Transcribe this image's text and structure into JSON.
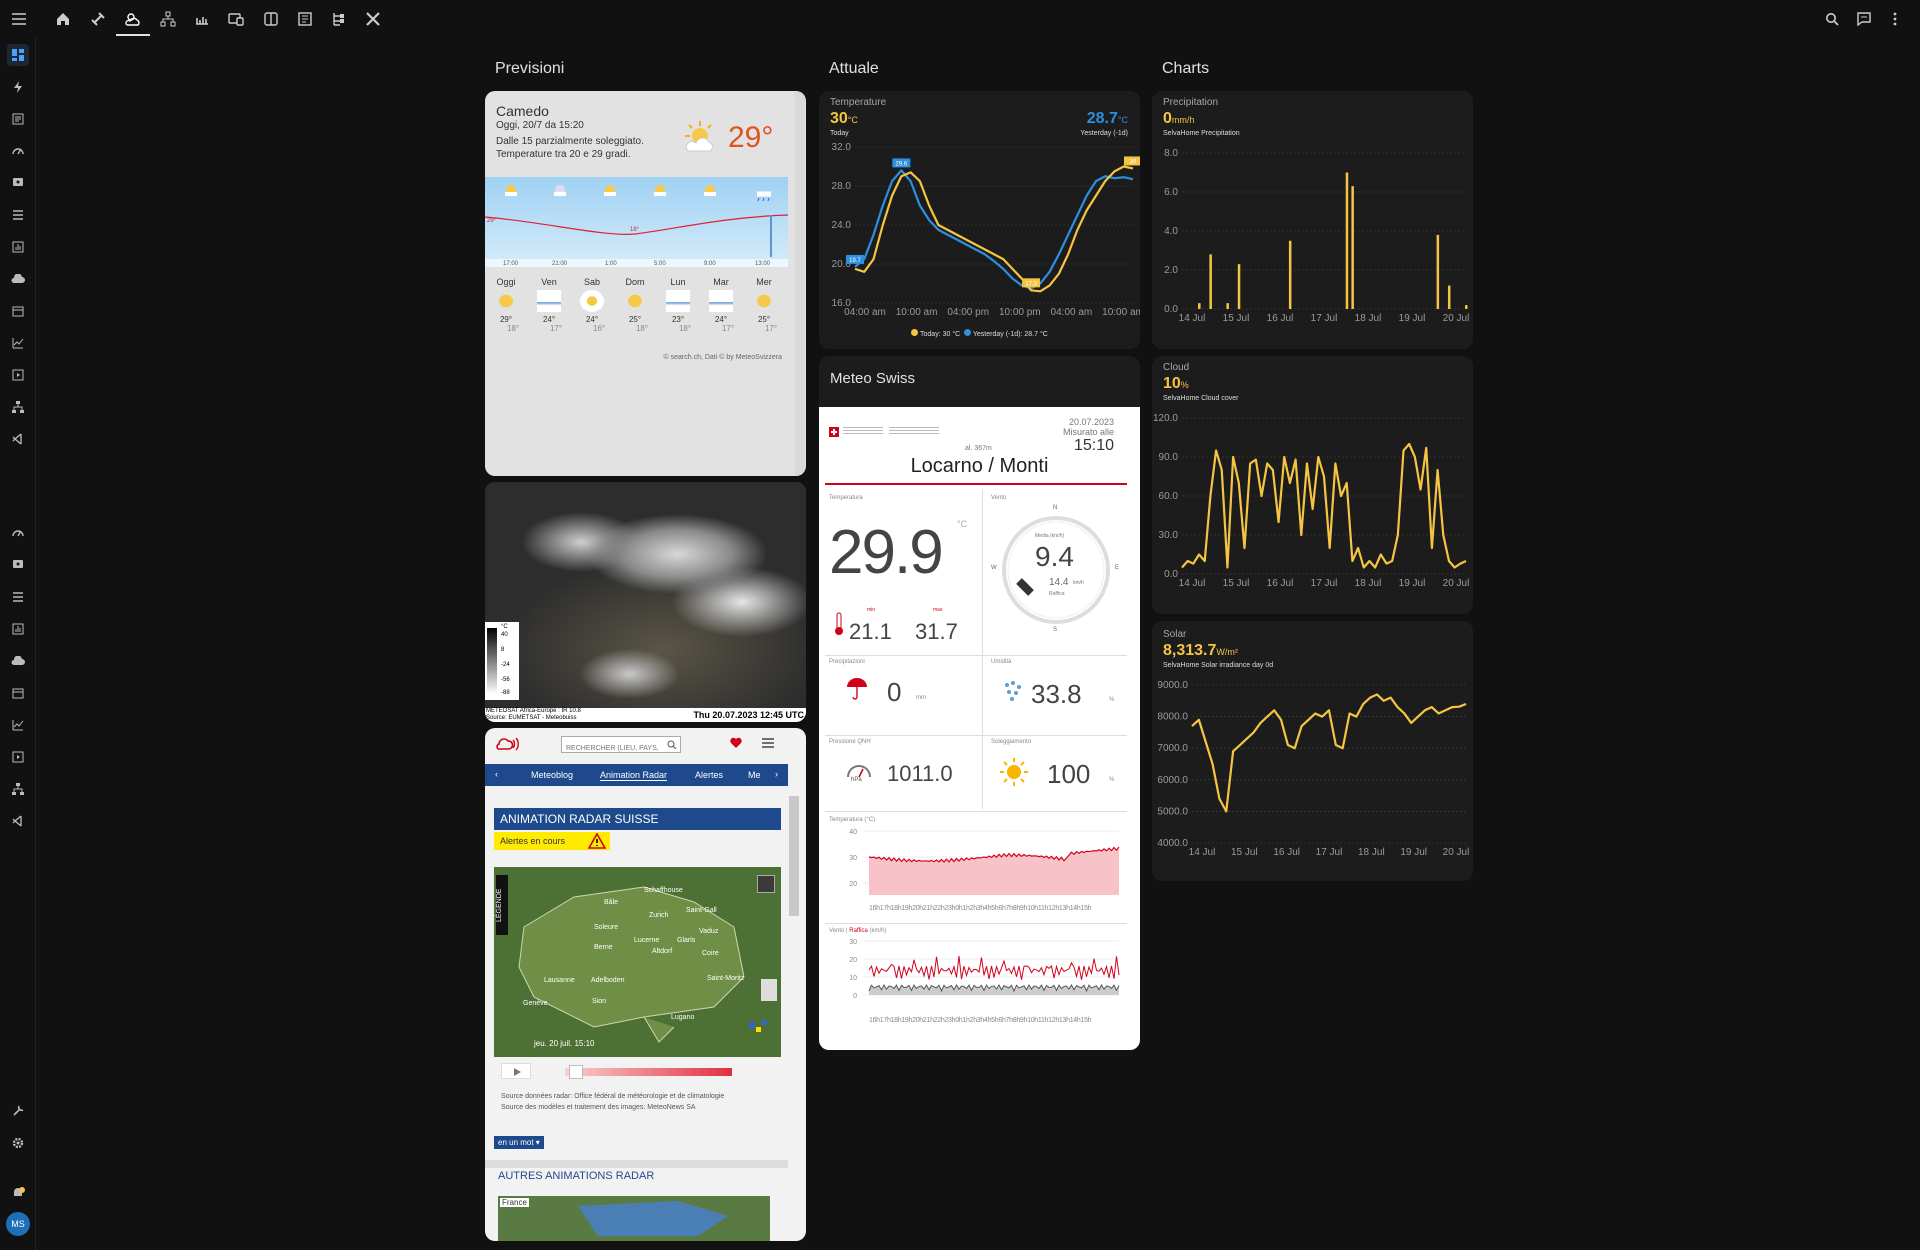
{
  "topbar": {
    "icons": [
      "menu-icon",
      "home-icon",
      "plug-icon",
      "weather-icon",
      "network-icon",
      "energy-icon",
      "media-icon",
      "tablet-icon",
      "panel-icon",
      "tree-icon",
      "tools-icon"
    ],
    "right_icons": [
      "search-icon",
      "chat-icon",
      "more-icon"
    ]
  },
  "columns": {
    "previsioni": "Previsioni",
    "attuale": "Attuale",
    "charts": "Charts"
  },
  "forecast": {
    "location": "Camedo",
    "date": "Oggi, 20/7 da 15:20",
    "desc1": "Dalle 15 parzialmente soleggiato.",
    "desc2": "Temperature tra 20 e 29 gradi.",
    "temp": "29°",
    "hours": [
      "17:00",
      "21:00",
      "1:00",
      "5:00",
      "9:00",
      "13:00"
    ],
    "hi_mark": "29°",
    "lo_mark": "18°",
    "days": [
      {
        "name": "Oggi",
        "hi": "29°",
        "lo": "18°"
      },
      {
        "name": "Ven",
        "hi": "24°",
        "lo": "17°"
      },
      {
        "name": "Sab",
        "hi": "24°",
        "lo": "16°"
      },
      {
        "name": "Dom",
        "hi": "25°",
        "lo": "18°"
      },
      {
        "name": "Lun",
        "hi": "23°",
        "lo": "18°"
      },
      {
        "name": "Mar",
        "hi": "24°",
        "lo": "17°"
      },
      {
        "name": "Mer",
        "hi": "25°",
        "lo": "17°"
      }
    ],
    "credit": "© search.ch, Dati © by MeteoSvizzera"
  },
  "satellite": {
    "caption1": "METEOSAT Africa-Europe : IR 10.8",
    "caption2": "Source: EUMETSAT - Meteobuiss",
    "timestamp": "Thu 20.07.2023 12:45 UTC",
    "scale": [
      "°C",
      "40",
      "8",
      "-24",
      "-56",
      "-88"
    ]
  },
  "radar": {
    "search_placeholder": "RECHERCHER (LIEU, PAYS, SON",
    "tabs": [
      "Meteoblog",
      "Animation Radar",
      "Alertes",
      "Me"
    ],
    "title": "ANIMATION RADAR SUISSE",
    "alerts": "Alertes en cours",
    "legend": "LÉGENDE",
    "cities": [
      {
        "n": "Schaffhouse"
      },
      {
        "n": "Bâle"
      },
      {
        "n": "Zurich"
      },
      {
        "n": "Saint-Gall"
      },
      {
        "n": "Soleure"
      },
      {
        "n": "Vaduz"
      },
      {
        "n": "Berne"
      },
      {
        "n": "Lucerne"
      },
      {
        "n": "Glaris"
      },
      {
        "n": "Altdorf"
      },
      {
        "n": "Coire"
      },
      {
        "n": "Lausanne"
      },
      {
        "n": "Adelboden"
      },
      {
        "n": "Saint-Moritz"
      },
      {
        "n": "Genève"
      },
      {
        "n": "Sion"
      },
      {
        "n": "Lugano"
      }
    ],
    "time": "jeu. 20 juil.   15:10",
    "source1": "Source données radar: Office fédéral de météorologie et de climatologie",
    "source2": "Source des modèles et traitement des images: MeteoNews SA",
    "enunmot": "en un mot",
    "other": "AUTRES ANIMATIONS RADAR",
    "france": "France"
  },
  "temperature_card": {
    "label": "Temperature",
    "today_val": "30",
    "today_unit": "°C",
    "today_lbl": "Today",
    "yest_val": "28.7",
    "yest_unit": "°C",
    "yest_lbl": "Yesterday (-1d)",
    "legend_today": "Today: 30 °C",
    "legend_yest": "Yesterday (-1d): 28.7 °C",
    "y_ticks": [
      "32.0",
      "28.0",
      "24.0",
      "20.0",
      "16.0"
    ],
    "x_ticks": [
      "04:00 am",
      "10:00 am",
      "04:00 pm",
      "10:00 pm",
      "04:00 am",
      "10:00 am"
    ],
    "marks": {
      "peak": "29.6",
      "start": "19.7",
      "low": "17.3",
      "end": "30"
    }
  },
  "meteoswiss": {
    "title": "Meteo Swiss",
    "date": "20.07.2023",
    "measured": "Misurato alle",
    "time": "15:10",
    "alt": "al. 367m",
    "station": "Locarno / Monti",
    "temp_lbl": "Temperatura",
    "temp": "29.9",
    "temp_unit": "°C",
    "min": "21.1",
    "max": "31.7",
    "min_lbl": "min",
    "max_lbl": "max",
    "wind_lbl": "Vento",
    "wind": "9.4",
    "wind_media": "Media (km/h)",
    "gust": "14.4",
    "gust_unit": "km/h",
    "gust_lbl": "Raffica",
    "compass": [
      "N",
      "E",
      "S",
      "W"
    ],
    "precip_lbl": "Precipitazioni",
    "precip": "0",
    "precip_unit": "mm",
    "hum_lbl": "Umidità",
    "hum": "33.8",
    "hum_unit": "%",
    "press_lbl": "Pressione QNH",
    "press": "1011.0",
    "press_unit": "hPa",
    "sun_lbl": "Soleggiamento",
    "sun": "100",
    "sun_unit": "%",
    "tchart_lbl": "Temperatura (°C)",
    "wchart_lbl": "Vento",
    "wchart_raffica": "Raffica",
    "wchart_unit": "(km/h)",
    "t_ticks": [
      "40",
      "30",
      "20"
    ],
    "w_ticks": [
      "30",
      "20",
      "10",
      "0"
    ],
    "x_ticks": "16h17h18h19h20h21h22h23h0h1h2h3h4h5h6h7h8h9h10h11h12h13h14h15h"
  },
  "precip_card": {
    "label": "Precipitation",
    "value": "0",
    "unit": "mm/h",
    "source": "SelvaHome Precipitation",
    "y_ticks": [
      "8.0",
      "6.0",
      "4.0",
      "2.0",
      "0.0"
    ],
    "x_ticks": [
      "14 Jul",
      "15 Jul",
      "16 Jul",
      "17 Jul",
      "18 Jul",
      "19 Jul",
      "20 Jul"
    ]
  },
  "cloud_card": {
    "label": "Cloud",
    "value": "10",
    "unit": "%",
    "source": "SelvaHome Cloud cover",
    "y_ticks": [
      "120.0",
      "90.0",
      "60.0",
      "30.0",
      "0.0"
    ],
    "x_ticks": [
      "14 Jul",
      "15 Jul",
      "16 Jul",
      "17 Jul",
      "18 Jul",
      "19 Jul",
      "20 Jul"
    ]
  },
  "solar_card": {
    "label": "Solar",
    "value": "8,313.7",
    "unit": "W/m²",
    "source": "SelvaHome Solar irradiance day 0d",
    "y_ticks": [
      "9000.0",
      "8000.0",
      "7000.0",
      "6000.0",
      "5000.0",
      "4000.0"
    ],
    "x_ticks": [
      "14 Jul",
      "15 Jul",
      "16 Jul",
      "17 Jul",
      "18 Jul",
      "19 Jul",
      "20 Jul"
    ]
  },
  "user": {
    "initials": "MS"
  },
  "colors": {
    "accent": "#f5c542",
    "blue": "#2e8ee0",
    "red": "#d0021b",
    "swiss_blue": "#1e4a8d"
  },
  "chart_data": [
    {
      "type": "line",
      "title": "Temperature",
      "ylim": [
        16,
        32
      ],
      "series": [
        {
          "name": "Today",
          "x": [
            0,
            1,
            2,
            3,
            4,
            5,
            6,
            7,
            8,
            9,
            10,
            11,
            12,
            13,
            14,
            15,
            16,
            17,
            18,
            19,
            20,
            21,
            22,
            23,
            24,
            25,
            26,
            27,
            28,
            29,
            30
          ],
          "values": [
            19.5,
            19.2,
            20.5,
            24,
            27,
            29,
            29.4,
            28.5,
            26,
            24,
            23.5,
            23,
            22.5,
            22,
            21.5,
            21,
            20.5,
            19.5,
            18.5,
            17.3,
            17.2,
            17.8,
            19,
            21,
            23.5,
            25.5,
            27,
            28.5,
            29.5,
            30,
            29.8
          ]
        },
        {
          "name": "Yesterday (-1d)",
          "x": [
            0,
            1,
            2,
            3,
            4,
            5,
            6,
            7,
            8,
            9,
            10,
            11,
            12,
            13,
            14,
            15,
            16,
            17,
            18,
            19,
            20,
            21,
            22,
            23,
            24,
            25,
            26,
            27,
            28,
            29,
            30
          ],
          "values": [
            19.7,
            20.5,
            23,
            26,
            28.5,
            29.6,
            28.5,
            26,
            24.5,
            23.5,
            23,
            22.5,
            22,
            21.5,
            21,
            20.3,
            19.5,
            18.5,
            17.8,
            17.5,
            18,
            19.2,
            21,
            23,
            25,
            27,
            28.5,
            29,
            28.8,
            28.9,
            28.7
          ]
        }
      ]
    },
    {
      "type": "bar",
      "title": "Precipitation",
      "ylim": [
        0,
        8
      ],
      "series": [
        {
          "name": "SelvaHome Precipitation",
          "x": [
            0,
            1,
            2,
            3,
            4,
            5,
            6,
            7,
            8,
            9,
            10,
            11,
            12,
            13,
            14,
            15,
            16,
            17,
            18,
            19,
            20,
            21,
            22,
            23,
            24,
            25,
            26,
            27,
            28,
            29,
            30,
            31,
            32,
            33,
            34,
            35,
            36,
            37,
            38,
            39,
            40,
            41,
            42,
            43,
            44,
            45,
            46,
            47,
            48,
            49,
            50
          ],
          "values": [
            0,
            0,
            0,
            0.3,
            0,
            2.8,
            0,
            0,
            0.3,
            0,
            2.3,
            0,
            0,
            0,
            0,
            0,
            0,
            0,
            0,
            3.5,
            0,
            0,
            0,
            0,
            0,
            0,
            0,
            0,
            0,
            7,
            6.3,
            0,
            0,
            0,
            0,
            0,
            0,
            0,
            0,
            0,
            0,
            0,
            0,
            0,
            0,
            3.8,
            0,
            1.2,
            0,
            0,
            0.2
          ]
        }
      ]
    },
    {
      "type": "line",
      "title": "Cloud",
      "ylim": [
        0,
        120
      ],
      "series": [
        {
          "name": "SelvaHome Cloud cover",
          "x": [
            0,
            1,
            2,
            3,
            4,
            5,
            6,
            7,
            8,
            9,
            10,
            11,
            12,
            13,
            14,
            15,
            16,
            17,
            18,
            19,
            20,
            21,
            22,
            23,
            24,
            25,
            26,
            27,
            28,
            29,
            30,
            31,
            32,
            33,
            34,
            35,
            36,
            37,
            38,
            39,
            40,
            41,
            42,
            43,
            44,
            45,
            46,
            47,
            48,
            49,
            50
          ],
          "values": [
            5,
            10,
            8,
            15,
            10,
            60,
            95,
            80,
            5,
            90,
            70,
            20,
            85,
            88,
            60,
            85,
            80,
            40,
            90,
            70,
            88,
            30,
            85,
            50,
            90,
            75,
            20,
            85,
            60,
            70,
            10,
            20,
            5,
            10,
            5,
            15,
            8,
            10,
            30,
            95,
            100,
            90,
            65,
            97,
            20,
            80,
            30,
            10,
            5,
            8,
            10
          ]
        }
      ]
    },
    {
      "type": "line",
      "title": "Solar",
      "ylim": [
        4000,
        9000
      ],
      "series": [
        {
          "name": "SelvaHome Solar irradiance day 0d",
          "x": [
            0,
            1,
            2,
            3,
            4,
            5,
            6,
            7,
            8,
            9,
            10,
            11,
            12,
            13,
            14,
            15,
            16,
            17,
            18,
            19,
            20,
            21,
            22,
            23,
            24,
            25,
            26,
            27,
            28,
            29,
            30,
            31,
            32,
            33,
            34,
            35,
            36,
            37,
            38,
            39,
            40
          ],
          "values": [
            7700,
            7900,
            7200,
            6500,
            5400,
            5000,
            6900,
            7100,
            7300,
            7500,
            7800,
            8000,
            8200,
            7900,
            7100,
            7000,
            7700,
            7900,
            8100,
            8000,
            8200,
            7100,
            7000,
            8100,
            8000,
            8400,
            8600,
            8700,
            8500,
            8600,
            8300,
            8100,
            7800,
            8000,
            8200,
            8300,
            8100,
            8200,
            8300,
            8313.7,
            8400
          ]
        }
      ]
    }
  ]
}
